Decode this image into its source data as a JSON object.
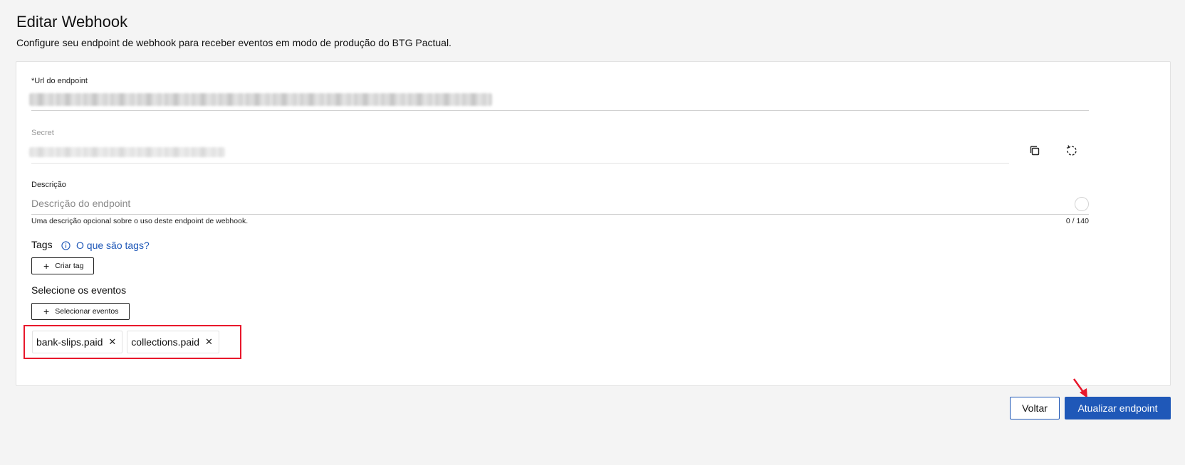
{
  "header": {
    "title": "Editar Webhook",
    "subtitle": "Configure seu endpoint de webhook para receber eventos em modo de produção do BTG Pactual."
  },
  "form": {
    "url": {
      "label": "*Url do endpoint"
    },
    "secret": {
      "label": "Secret",
      "copy_icon": "copy-icon",
      "regenerate_icon": "refresh-icon"
    },
    "description": {
      "label": "Descrição",
      "placeholder": "Descrição do endpoint",
      "helper": "Uma descrição opcional sobre o uso deste endpoint de webhook.",
      "counter": "0 / 140"
    },
    "tags": {
      "title": "Tags",
      "info_link": "O que são tags?",
      "create_button": "Criar tag"
    },
    "events": {
      "title": "Selecione os eventos",
      "select_button": "Selecionar eventos",
      "selected": [
        "bank-slips.paid",
        "collections.paid"
      ]
    }
  },
  "footer": {
    "back_button": "Voltar",
    "submit_button": "Atualizar endpoint"
  },
  "colors": {
    "primary": "#1f58b8",
    "highlight": "#e8172b",
    "background": "#f4f4f4"
  }
}
